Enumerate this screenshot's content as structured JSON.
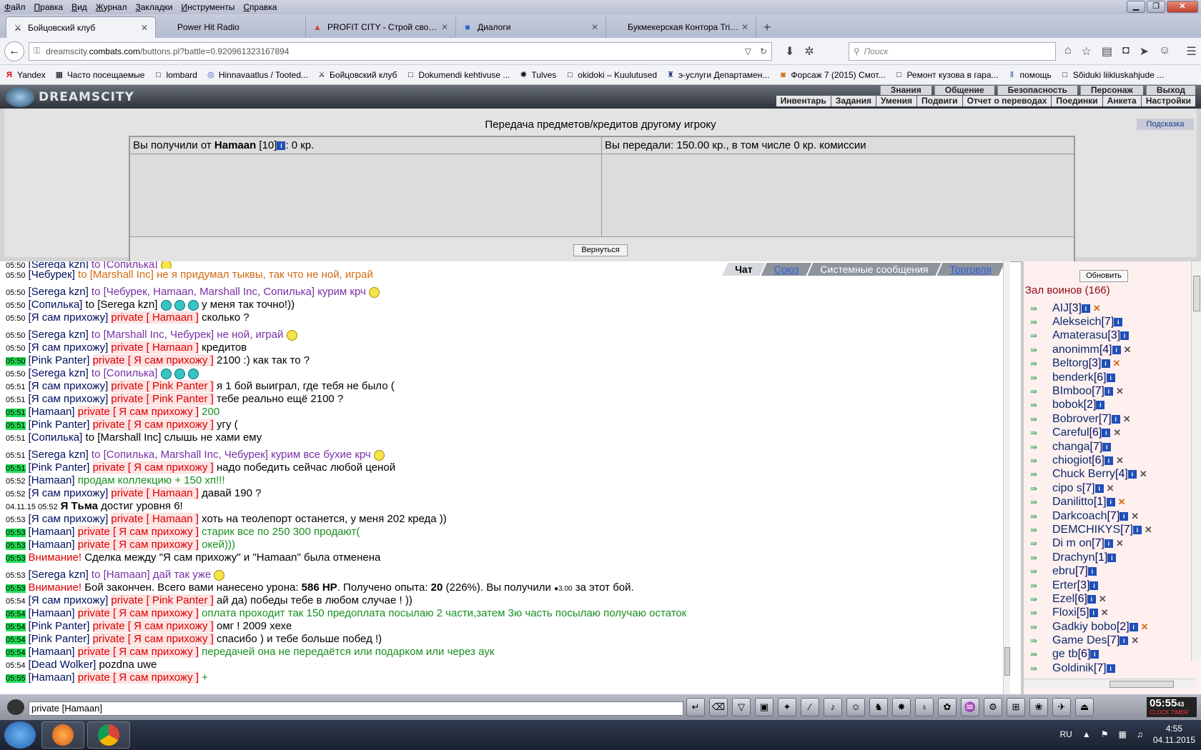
{
  "browser": {
    "menu": [
      "Файл",
      "Правка",
      "Вид",
      "Журнал",
      "Закладки",
      "Инструменты",
      "Справка"
    ],
    "tabs": [
      {
        "label": "Бойцовский клуб",
        "icon": "swords-icon",
        "active": true
      },
      {
        "label": "Power Hit Radio",
        "icon": "radio-icon",
        "active": false
      },
      {
        "label": "PROFIT CITY - Строй свой...",
        "icon": "building-icon",
        "active": false
      },
      {
        "label": "Диалоги",
        "icon": "chat-icon",
        "active": false
      },
      {
        "label": "Букмекерская Контора Triobe...",
        "icon": "globe-icon",
        "active": false
      }
    ],
    "url_prefix": "dreamscity.",
    "url_host": "combats.com",
    "url_path": "/buttons.pl?battle=0.920961323167894",
    "search_placeholder": "Поиск",
    "bookmarks": [
      "Yandex",
      "Часто посещаемые",
      "lombard",
      "Hinnavaatlus / Tooted...",
      "Бойцовский клуб",
      "Dokumendi kehtivuse ...",
      "Tulves",
      "okidoki – Kuulutused",
      "э-услуги Департамен...",
      "Форсаж 7 (2015) Смот...",
      "Ремонт кузова в гара...",
      "помощь",
      "Sõiduki liikluskahjude ..."
    ]
  },
  "game": {
    "logo": "DREAMSCITY",
    "top_menu": [
      "Знания",
      "Общение",
      "Безопасность",
      "Персонаж",
      "Выход"
    ],
    "sub_menu": [
      "Инвентарь",
      "Задания",
      "Умения",
      "Подвиги",
      "Отчет о переводах",
      "Поединки",
      "Анкета",
      "Настройки"
    ],
    "panel_title": "Передача предметов/кредитов другому игроку",
    "hint_button": "Подсказка",
    "received_prefix": "Вы получили от",
    "received_name": "Hamaan",
    "received_level": "[10]",
    "received_amount": ": 0 кр.",
    "sent_text": "Вы передали: 150.00 кр., в том числе 0 кр. комиссии",
    "return_button": "Вернуться"
  },
  "chat": {
    "tabs": [
      "Чат",
      "Союз",
      "Системные сообщения",
      "Торговля"
    ],
    "input_value": "private [Hamaan]"
  },
  "users": {
    "refresh_button": "Обновить",
    "hall_title": "Зал воинов (166)",
    "list": [
      {
        "name": "AIJ",
        "level": "[3]",
        "x": "or"
      },
      {
        "name": "Alekseich",
        "level": "[7]",
        "x": ""
      },
      {
        "name": "Amaterasu",
        "level": "[3]",
        "x": ""
      },
      {
        "name": "anonimm",
        "level": "[4]",
        "x": "gr"
      },
      {
        "name": "Beltorg",
        "level": "[3]",
        "x": "or"
      },
      {
        "name": "benderk",
        "level": "[6]",
        "x": ""
      },
      {
        "name": "BImboo",
        "level": "[7]",
        "x": "gr"
      },
      {
        "name": "bobok",
        "level": "[2]",
        "x": ""
      },
      {
        "name": "Bobrover",
        "level": "[7]",
        "x": "gr"
      },
      {
        "name": "Careful",
        "level": "[6]",
        "x": "gr"
      },
      {
        "name": "changa",
        "level": "[7]",
        "x": ""
      },
      {
        "name": "chiogiot",
        "level": "[6]",
        "x": "gr"
      },
      {
        "name": "Chuck Berry",
        "level": "[4]",
        "x": "gr"
      },
      {
        "name": "cipo s",
        "level": "[7]",
        "x": "gr"
      },
      {
        "name": "Danilitto",
        "level": "[1]",
        "x": "or"
      },
      {
        "name": "Darkcoach",
        "level": "[7]",
        "x": "gr"
      },
      {
        "name": "DEMCHIKYS",
        "level": "[7]",
        "x": "gr"
      },
      {
        "name": "Di m on",
        "level": "[7]",
        "x": "gr"
      },
      {
        "name": "Drachyn",
        "level": "[1]",
        "x": ""
      },
      {
        "name": "ebru",
        "level": "[7]",
        "x": ""
      },
      {
        "name": "Erter",
        "level": "[3]",
        "x": ""
      },
      {
        "name": "Ezel",
        "level": "[6]",
        "x": "gr"
      },
      {
        "name": "Floxi",
        "level": "[5]",
        "x": "gr"
      },
      {
        "name": "Gadkiy bobo",
        "level": "[2]",
        "x": "or"
      },
      {
        "name": "Game Des",
        "level": "[7]",
        "x": "gr"
      },
      {
        "name": "ge tb",
        "level": "[6]",
        "x": ""
      },
      {
        "name": "Goldinik",
        "level": "[7]",
        "x": ""
      }
    ]
  },
  "clock": {
    "time": "05:55",
    "sec": "43",
    "labels": "CLOCK TIMER"
  },
  "taskbar": {
    "lang": "RU",
    "time": "4:55",
    "date": "04.11.2015"
  }
}
